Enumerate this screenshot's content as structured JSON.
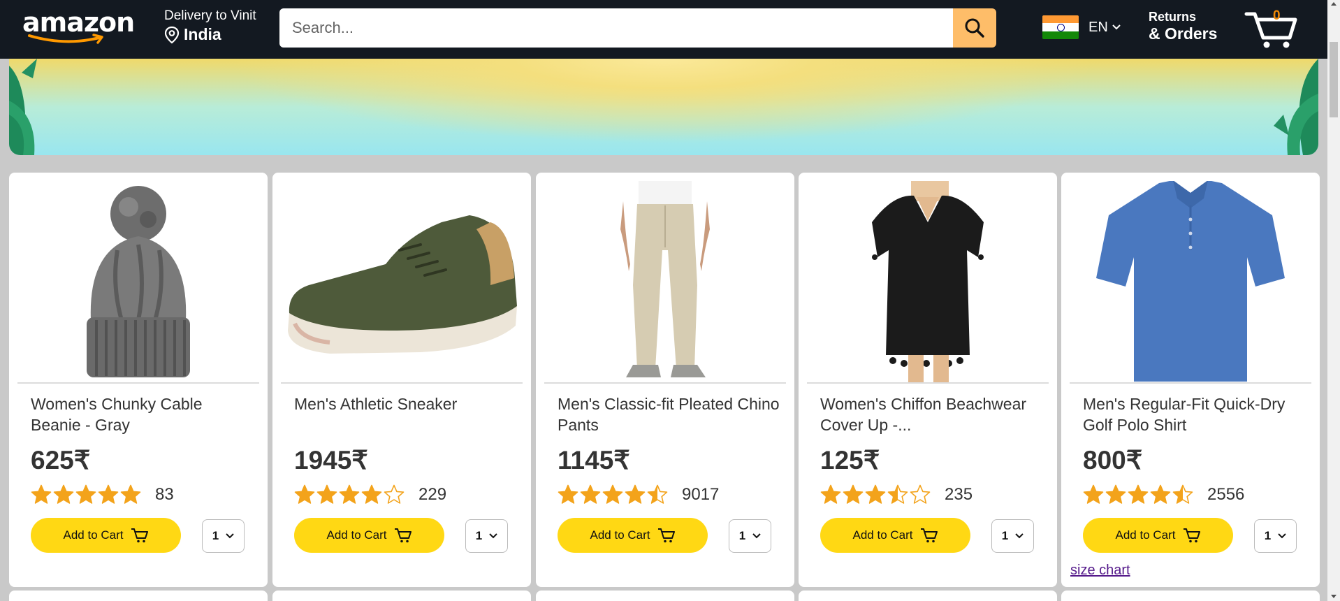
{
  "header": {
    "logo_text": "amazon",
    "delivery_label": "Delivery to Vinit",
    "delivery_location": "India",
    "search_placeholder": "Search...",
    "language": "EN",
    "orders_line1": "Returns",
    "orders_line2": "& Orders",
    "cart_count": "0",
    "colors": {
      "bar": "#131921",
      "search_button": "#febd69",
      "cart_count": "#f08804"
    }
  },
  "products": [
    {
      "title": "Women's Chunky Cable Beanie - Gray",
      "price": "625₹",
      "rating": 5,
      "review_count": "83",
      "add_label": "Add to Cart",
      "qty": "1"
    },
    {
      "title": "Men's Athletic Sneaker",
      "price": "1945₹",
      "rating": 4,
      "review_count": "229",
      "add_label": "Add to Cart",
      "qty": "1"
    },
    {
      "title": "Men's Classic-fit Pleated Chino Pants",
      "price": "1145₹",
      "rating": 4.5,
      "review_count": "9017",
      "add_label": "Add to Cart",
      "qty": "1"
    },
    {
      "title": "Women's Chiffon Beachwear Cover Up -...",
      "price": "125₹",
      "rating": 3.5,
      "review_count": "235",
      "add_label": "Add to Cart",
      "qty": "1"
    },
    {
      "title": "Men's Regular-Fit Quick-Dry Golf Polo Shirt",
      "price": "800₹",
      "rating": 4.5,
      "review_count": "2556",
      "add_label": "Add to Cart",
      "qty": "1",
      "extra_link": "size chart"
    }
  ],
  "colors": {
    "add_to_cart": "#ffd814",
    "star": "#f3a31b"
  }
}
